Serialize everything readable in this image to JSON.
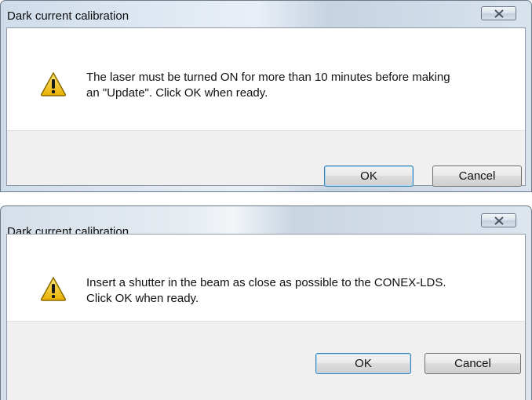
{
  "dialogs": [
    {
      "title": "Dark current calibration",
      "message_lines": [
        "The laser must be turned ON for more than 10 minutes before making",
        "an \"Update\". Click OK when ready."
      ],
      "ok_label": "OK",
      "cancel_label": "Cancel",
      "icon": "warning-icon"
    },
    {
      "title": "Dark current calibration",
      "message_lines": [
        "Insert a shutter in the beam as close as possible to the CONEX-LDS.",
        "Click OK when ready."
      ],
      "ok_label": "OK",
      "cancel_label": "Cancel",
      "icon": "warning-icon"
    }
  ],
  "close_glyph": "close-icon",
  "colors": {
    "warning_fill": "#f5c400",
    "warning_border": "#8a6a00",
    "default_button_border": "#3c7fb1"
  }
}
